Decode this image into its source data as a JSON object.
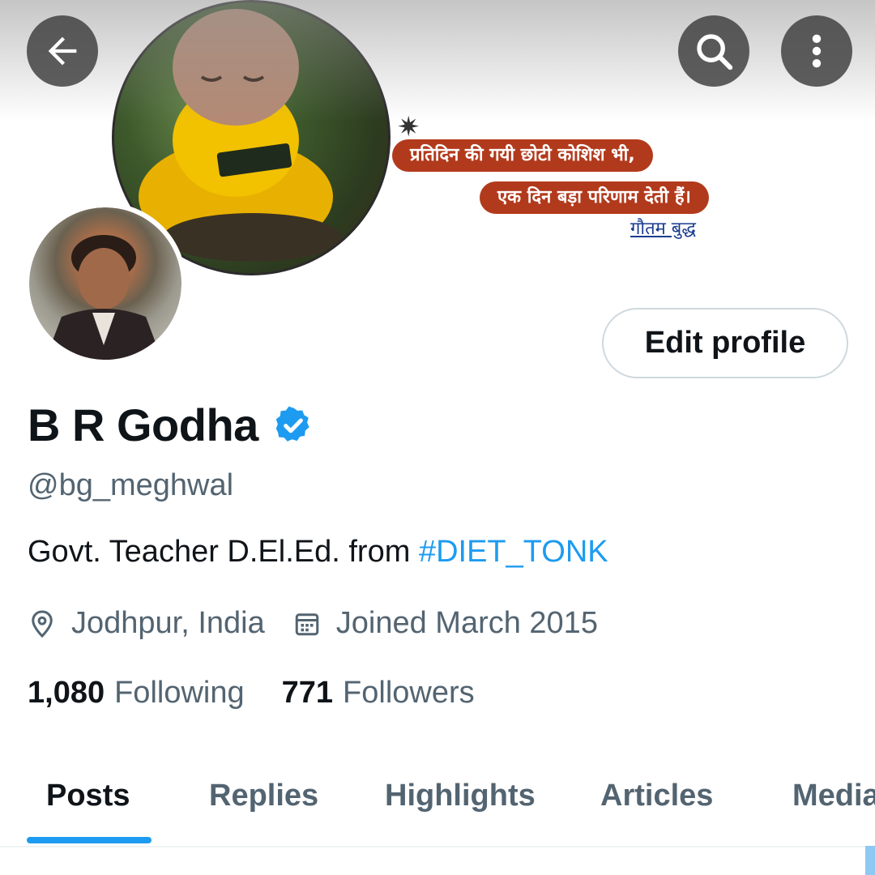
{
  "banner": {
    "quote_line1": "प्रतिदिन की गयी छोटी कोशिश भी,",
    "quote_line2": "एक दिन बड़ा परिणाम देती हैं।",
    "quote_author": "गौतम बुद्ध",
    "star_glyph": "✷"
  },
  "top_bar": {
    "back_icon": "back-arrow-icon",
    "search_icon": "search-icon",
    "more_icon": "more-vertical-icon"
  },
  "profile": {
    "edit_label": "Edit profile",
    "name": "B R Godha",
    "handle": "@bg_meghwal",
    "bio_text": "Govt. Teacher D.El.Ed. from ",
    "bio_hashtag": "#DIET_TONK",
    "location": "Jodhpur, India",
    "joined": "Joined March 2015",
    "following_count": "1,080",
    "following_label": "Following",
    "followers_count": "771",
    "followers_label": "Followers"
  },
  "tabs": [
    {
      "label": "Posts",
      "active": true
    },
    {
      "label": "Replies",
      "active": false
    },
    {
      "label": "Highlights",
      "active": false
    },
    {
      "label": "Articles",
      "active": false
    },
    {
      "label": "Media",
      "active": false
    }
  ],
  "colors": {
    "accent": "#1d9bf0",
    "text_primary": "#0f1419",
    "text_secondary": "#536471",
    "quote_pill": "#b23a1c"
  }
}
